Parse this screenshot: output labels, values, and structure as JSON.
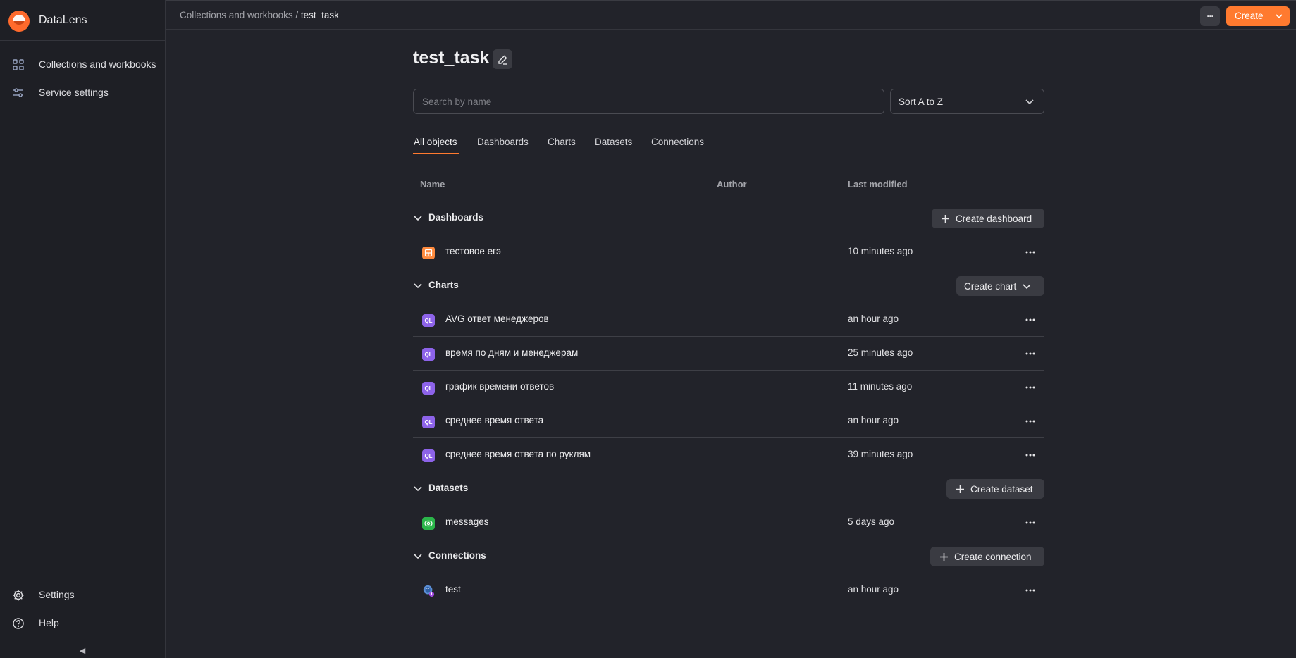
{
  "app": {
    "name": "DataLens"
  },
  "sidebar": {
    "items": [
      {
        "label": "Collections and workbooks",
        "icon": "grid-icon"
      },
      {
        "label": "Service settings",
        "icon": "sliders-icon"
      }
    ],
    "bottom": [
      {
        "label": "Settings",
        "icon": "gear-icon"
      },
      {
        "label": "Help",
        "icon": "help-icon"
      }
    ],
    "collapse_glyph": "◀"
  },
  "header": {
    "breadcrumb": {
      "parent": "Collections and workbooks",
      "separator": "/",
      "current": "test_task"
    },
    "more_glyph": "···",
    "create_label": "Create"
  },
  "main": {
    "title": "test_task",
    "search": {
      "placeholder": "Search by name",
      "value": ""
    },
    "sort": {
      "value": "Sort A to Z"
    },
    "tabs": [
      {
        "label": "All objects",
        "active": true
      },
      {
        "label": "Dashboards",
        "active": false
      },
      {
        "label": "Charts",
        "active": false
      },
      {
        "label": "Datasets",
        "active": false
      },
      {
        "label": "Connections",
        "active": false
      }
    ],
    "columns": {
      "name": "Name",
      "author": "Author",
      "modified": "Last modified"
    },
    "groups": {
      "dashboards": {
        "title": "Dashboards",
        "button": "Create dashboard",
        "items": [
          {
            "name": "тестовое егэ",
            "author": "",
            "modified": "10 minutes ago",
            "icon": "dashboard-icon"
          }
        ]
      },
      "charts": {
        "title": "Charts",
        "button": "Create chart",
        "items": [
          {
            "name": "AVG ответ менеджеров",
            "author": "",
            "modified": "an hour ago",
            "icon": "ql-chart-icon",
            "badge": "QL"
          },
          {
            "name": "время по дням и менеджерам",
            "author": "",
            "modified": "25 minutes ago",
            "icon": "ql-chart-icon",
            "badge": "QL"
          },
          {
            "name": "график времени ответов",
            "author": "",
            "modified": "11 minutes ago",
            "icon": "ql-chart-icon",
            "badge": "QL"
          },
          {
            "name": "среднее время ответа",
            "author": "",
            "modified": "an hour ago",
            "icon": "ql-chart-icon",
            "badge": "QL"
          },
          {
            "name": "среднее время ответа по руклям",
            "author": "",
            "modified": "39 minutes ago",
            "icon": "ql-chart-icon",
            "badge": "QL"
          }
        ]
      },
      "datasets": {
        "title": "Datasets",
        "button": "Create dataset",
        "items": [
          {
            "name": "messages",
            "author": "",
            "modified": "5 days ago",
            "icon": "dataset-icon"
          }
        ]
      },
      "connections": {
        "title": "Connections",
        "button": "Create connection",
        "items": [
          {
            "name": "test",
            "author": "",
            "modified": "an hour ago",
            "icon": "postgresql-icon"
          }
        ]
      }
    }
  },
  "colors": {
    "accent": "#ff7a2f",
    "background": "#22232a",
    "sidebar": "#1e1f25",
    "button": "#3a3b42",
    "ql_badge": "#8d63e9",
    "dashboard_badge": "#ff8a3d",
    "dataset_badge": "#2bb54a",
    "connection_badge": "#5b8fd6"
  }
}
